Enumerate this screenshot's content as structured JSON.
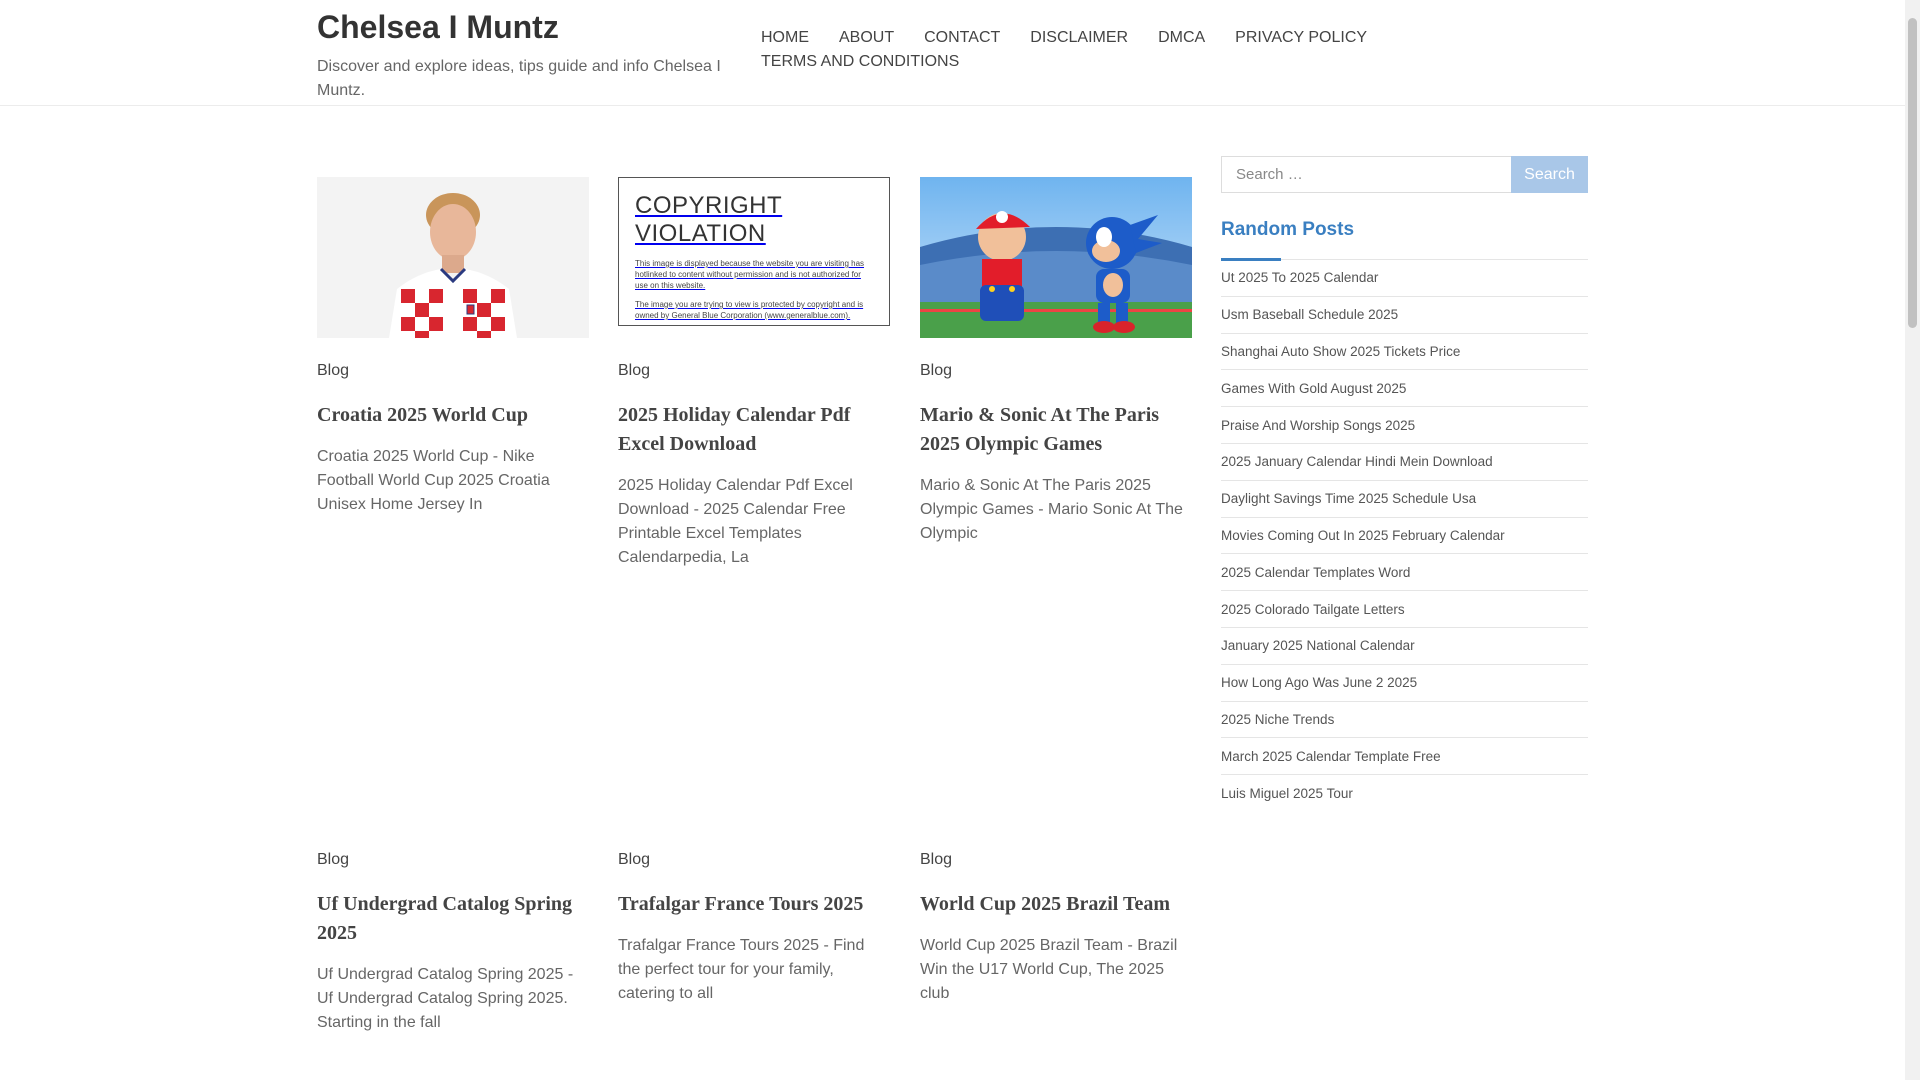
{
  "site": {
    "title": "Chelsea I Muntz",
    "description": "Discover and explore ideas, tips guide and info Chelsea I Muntz."
  },
  "nav": {
    "items": [
      "HOME",
      "ABOUT",
      "CONTACT",
      "DISCLAIMER",
      "DMCA",
      "PRIVACY POLICY",
      "TERMS AND CONDITIONS"
    ]
  },
  "thumbs": {
    "copyright_heading": "COPYRIGHT VIOLATION",
    "copyright_line1": "This image is displayed because the website you are visiting has hotlinked to content without permission and is not authorized for use on this website.",
    "copyright_line2": "The image you are trying to view is protected by copyright and is owned by General Blue Corporation (www.generalblue.com)."
  },
  "posts": [
    {
      "category": "Blog",
      "title": "Croatia 2025 World Cup",
      "excerpt": "Croatia 2025 World Cup - Nike Football World Cup 2025 Croatia Unisex Home Jersey In"
    },
    {
      "category": "Blog",
      "title": "2025 Holiday Calendar Pdf Excel Download",
      "excerpt": "2025 Holiday Calendar Pdf Excel Download - 2025 Calendar Free Printable Excel Templates Calendarpedia, La"
    },
    {
      "category": "Blog",
      "title": "Mario & Sonic At The Paris 2025 Olympic Games",
      "excerpt": "Mario & Sonic At The Paris 2025 Olympic Games - Mario Sonic At The Olympic"
    },
    {
      "category": "Blog",
      "title": "Uf Undergrad Catalog Spring 2025",
      "excerpt": "Uf Undergrad Catalog Spring 2025 - Uf Undergrad Catalog Spring 2025. Starting in the fall"
    },
    {
      "category": "Blog",
      "title": "Trafalgar France Tours 2025",
      "excerpt": "Trafalgar France Tours 2025 - Find the perfect tour for your family, catering to all"
    },
    {
      "category": "Blog",
      "title": "World Cup 2025 Brazil Team",
      "excerpt": "World Cup 2025 Brazil Team - Brazil Win the U17 World Cup, The 2025 club"
    }
  ],
  "search": {
    "placeholder": "Search …",
    "button_label": "Search"
  },
  "sidebar": {
    "widget_title": "Random Posts",
    "items": [
      "Ut 2025 To 2025 Calendar",
      "Usm Baseball Schedule 2025",
      "Shanghai Auto Show 2025 Tickets Price",
      "Games With Gold August 2025",
      "Praise And Worship Songs 2025",
      "2025 January Calendar Hindi Mein Download",
      "Daylight Savings Time 2025 Schedule Usa",
      "Movies Coming Out In 2025 February Calendar",
      "2025 Calendar Templates Word",
      "2025 Colorado Tailgate Letters",
      "January 2025 National Calendar",
      "How Long Ago Was June 2 2025",
      "2025 Niche Trends",
      "March 2025 Calendar Template Free",
      "Luis Miguel 2025 Tour"
    ]
  },
  "colors": {
    "accent": "#3a7fc1",
    "search_button": "#a9c7e8"
  }
}
